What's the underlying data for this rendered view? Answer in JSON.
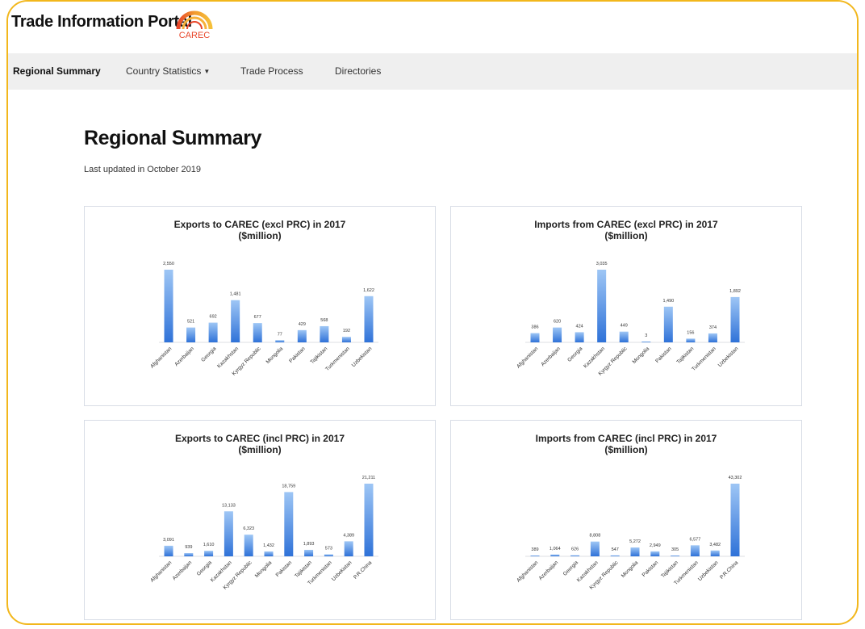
{
  "app": {
    "title": "Trade Information Portal",
    "logo_text": "CAREC"
  },
  "nav": {
    "items": [
      {
        "label": "Regional Summary",
        "active": true
      },
      {
        "label": "Country Statistics",
        "has_dropdown": true
      },
      {
        "label": "Trade Process"
      },
      {
        "label": "Directories"
      }
    ]
  },
  "page": {
    "title": "Regional Summary",
    "updated": "Last updated in October 2019"
  },
  "colors": {
    "accent_border": "#f2b71c",
    "bar_top": "#9ec6f5",
    "bar_bottom": "#2f72d8"
  },
  "chart_data": [
    {
      "type": "bar",
      "title": "Exports to CAREC (excl PRC) in 2017",
      "subtitle": "($million)",
      "categories": [
        "Afghanistan",
        "Azerbaijan",
        "Georgia",
        "Kazakhstan",
        "Kyrgyz Republic",
        "Mongolia",
        "Pakistan",
        "Tajikistan",
        "Turkmenistan",
        "Uzbekistan"
      ],
      "values": [
        2550,
        521,
        692,
        1481,
        677,
        77,
        429,
        568,
        192,
        1622
      ],
      "labels": [
        "2,550",
        "521",
        "692",
        "1,481",
        "677",
        "77",
        "429",
        "568",
        "192",
        "1,622"
      ]
    },
    {
      "type": "bar",
      "title": "Imports from CAREC (excl PRC) in 2017",
      "subtitle": "($million)",
      "categories": [
        "Afghanistan",
        "Azerbaijan",
        "Georgia",
        "Kazakhstan",
        "Kyrgyz Republic",
        "Mongolia",
        "Pakistan",
        "Tajikistan",
        "Turkmenistan",
        "Uzbekistan"
      ],
      "values": [
        386,
        620,
        424,
        3035,
        449,
        3,
        1490,
        156,
        374,
        1892
      ],
      "labels": [
        "386",
        "620",
        "424",
        "3,035",
        "449",
        "3",
        "1,490",
        "156",
        "374",
        "1,892"
      ]
    },
    {
      "type": "bar",
      "title": "Exports to CAREC (incl PRC) in 2017",
      "subtitle": "($million)",
      "categories": [
        "Afghanistan",
        "Azerbaijan",
        "Georgia",
        "Kazakhstan",
        "Kyrgyz Republic",
        "Mongolia",
        "Pakistan",
        "Tajikistan",
        "Turkmenistan",
        "Uzbekistan",
        "P.R.China"
      ],
      "values": [
        3091,
        939,
        1610,
        13133,
        6323,
        1432,
        18759,
        1893,
        573,
        4389,
        21211
      ],
      "labels": [
        "3,091",
        "939",
        "1,610",
        "13,133",
        "6,323",
        "1,432",
        "18,759",
        "1,893",
        "573",
        "4,389",
        "21,211"
      ]
    },
    {
      "type": "bar",
      "title": "Imports from CAREC (incl PRC) in 2017",
      "subtitle": "($million)",
      "categories": [
        "Afghanistan",
        "Azerbaijan",
        "Georgia",
        "Kazakhstan",
        "Kyrgyz Republic",
        "Mongolia",
        "Pakistan",
        "Tajikistan",
        "Turkmenistan",
        "Uzbekistan",
        "P.R.China"
      ],
      "values": [
        389,
        1064,
        626,
        8808,
        547,
        5272,
        2949,
        305,
        6577,
        3482,
        43302
      ],
      "labels": [
        "389",
        "1,064",
        "626",
        "8,808",
        "547",
        "5,272",
        "2,949",
        "305",
        "6,577",
        "3,482",
        "43,302"
      ]
    }
  ]
}
